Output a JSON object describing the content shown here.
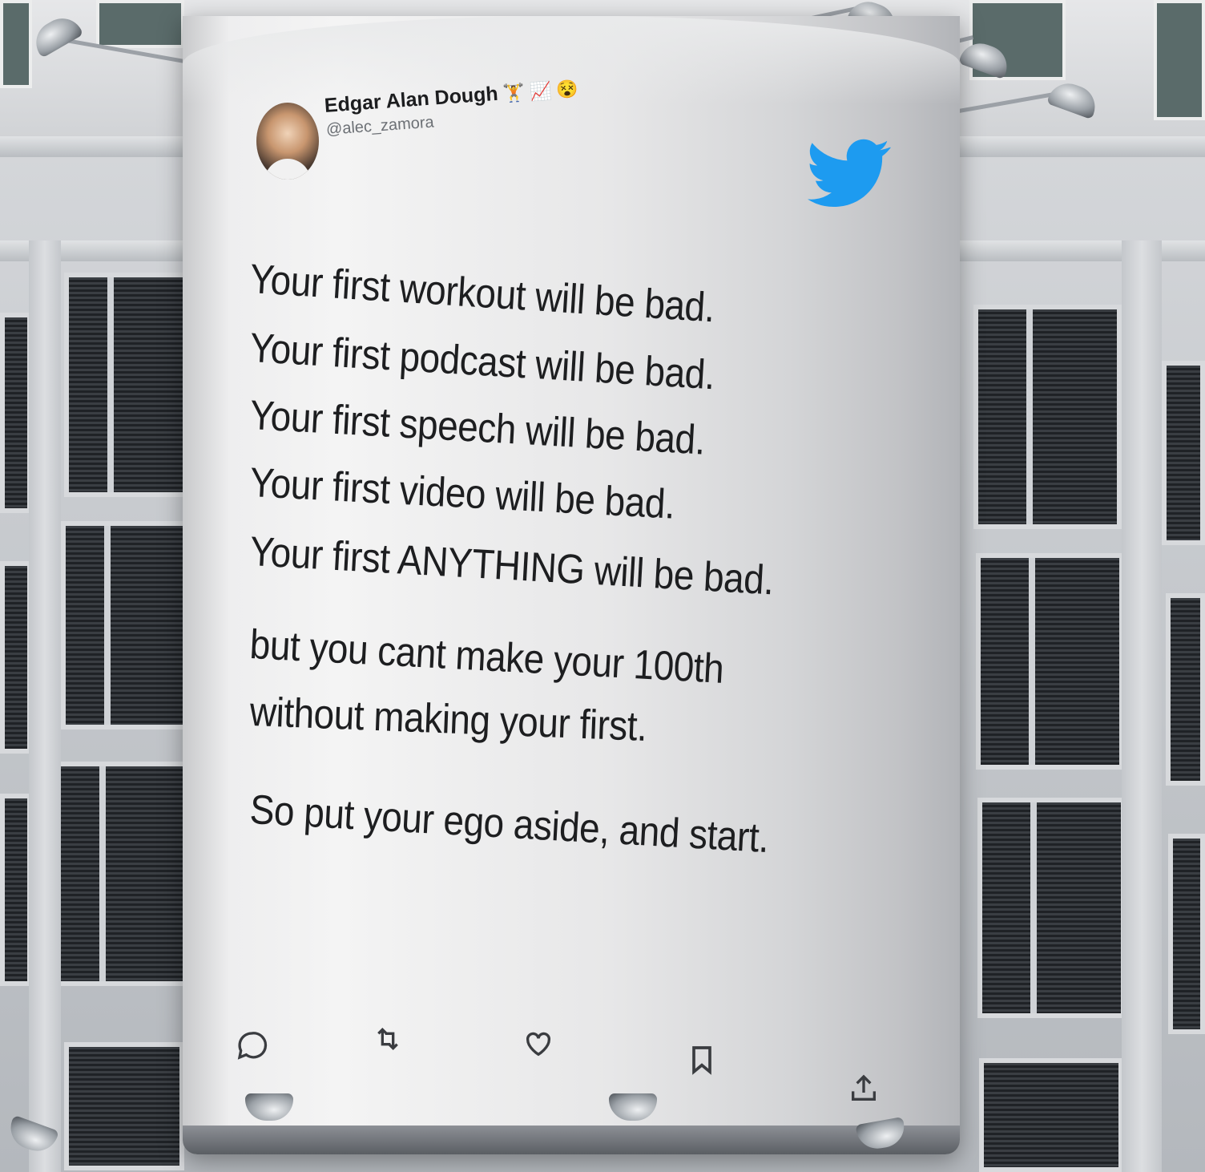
{
  "author": {
    "name": "Edgar Alan Dough",
    "handle": "@alec_zamora",
    "emojis": [
      "weightlifter",
      "chart-increasing",
      "face-dizzy"
    ]
  },
  "tweet": {
    "lines": [
      "Your first workout will be bad.",
      "Your first podcast will be bad.",
      "Your first speech will be bad.",
      "Your first video will be bad.",
      "Your first ANYTHING will be bad.",
      "but you cant make your 100th",
      "without making your first.",
      "So put your ego aside, and start."
    ]
  },
  "actions": {
    "reply": "reply-icon",
    "retweet": "retweet-icon",
    "like": "heart-icon",
    "bookmark": "bookmark-icon",
    "share": "share-icon"
  },
  "colors": {
    "brand": "#1d9bf0",
    "text": "#1d1e20",
    "handle": "#6c7075"
  }
}
